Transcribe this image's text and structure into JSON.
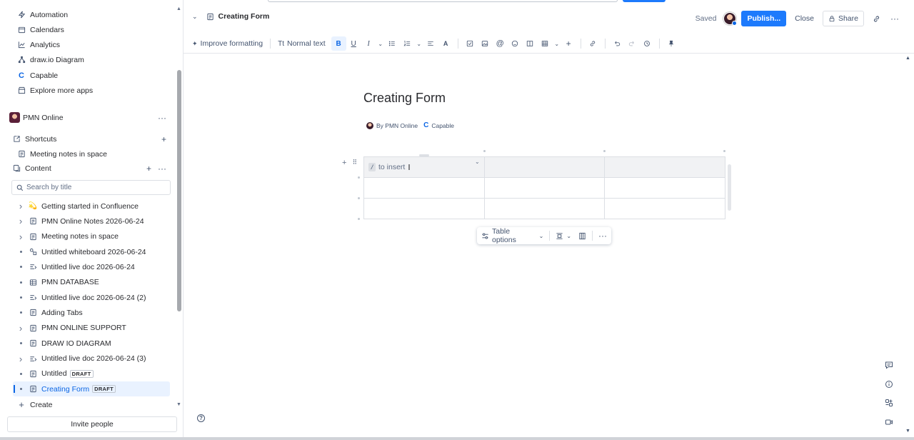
{
  "sidebar": {
    "apps": [
      {
        "label": "Automation",
        "icon": "lightning-icon"
      },
      {
        "label": "Calendars",
        "icon": "calendar-icon"
      },
      {
        "label": "Analytics",
        "icon": "chart-line-icon"
      },
      {
        "label": "draw.io Diagram",
        "icon": "drawio-icon"
      },
      {
        "label": "Capable",
        "icon": "capable-logo-icon"
      },
      {
        "label": "Explore more apps",
        "icon": "store-icon"
      }
    ],
    "space_name": "PMN Online",
    "shortcuts_label": "Shortcuts",
    "shortcut_item": "Meeting notes in space",
    "content_label": "Content",
    "search_placeholder": "Search by title",
    "tree": [
      {
        "label": "Getting started in Confluence",
        "marker": "caret",
        "icon": "emoji-icon"
      },
      {
        "label": "PMN Online Notes 2026-06-24",
        "marker": "caret",
        "icon": "page-icon"
      },
      {
        "label": "Meeting notes in space",
        "marker": "caret",
        "icon": "page-icon"
      },
      {
        "label": "Untitled whiteboard 2026-06-24",
        "marker": "dot",
        "icon": "whiteboard-icon"
      },
      {
        "label": "Untitled live doc 2026-06-24",
        "marker": "dot",
        "icon": "live-doc-icon"
      },
      {
        "label": "PMN DATABASE",
        "marker": "dot",
        "icon": "database-icon"
      },
      {
        "label": "Untitled live doc 2026-06-24 (2)",
        "marker": "dot",
        "icon": "live-doc-icon"
      },
      {
        "label": "Adding Tabs",
        "marker": "dot",
        "icon": "page-icon"
      },
      {
        "label": "PMN ONLINE SUPPORT",
        "marker": "caret",
        "icon": "page-icon"
      },
      {
        "label": "DRAW IO DIAGRAM",
        "marker": "dot",
        "icon": "page-icon"
      },
      {
        "label": "Untitled live doc 2026-06-24 (3)",
        "marker": "caret",
        "icon": "live-doc-icon"
      },
      {
        "label": "Untitled",
        "marker": "dot",
        "icon": "page-icon",
        "badge": "DRAFT"
      },
      {
        "label": "Creating Form",
        "marker": "dot",
        "icon": "page-icon",
        "badge": "DRAFT",
        "selected": true
      }
    ],
    "create_label": "Create",
    "invite_label": "Invite people"
  },
  "header": {
    "page_title": "Creating Form",
    "saved_label": "Saved",
    "publish_label": "Publish...",
    "close_label": "Close",
    "share_label": "Share"
  },
  "toolbar": {
    "improve_label": "Improve formatting",
    "text_style_label": "Normal text"
  },
  "editor": {
    "title": "Creating Form",
    "byline_author": "By PMN Online",
    "byline_app": "Capable",
    "cell_hint": "to insert",
    "slash_key": "/",
    "table_options_label": "Table options"
  },
  "colors": {
    "accent": "#1d7afc",
    "selected_bg": "#e9f2ff",
    "selected_text": "#0c66e4"
  }
}
